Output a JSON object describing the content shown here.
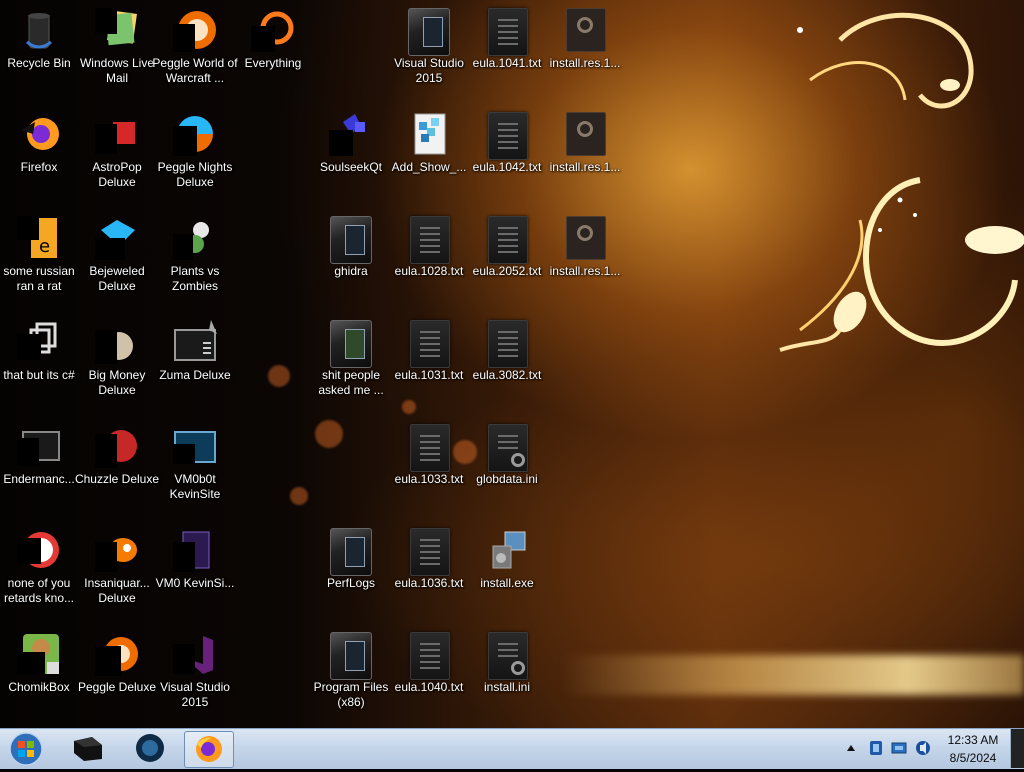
{
  "desktop": {
    "icons": [
      {
        "label": "Recycle Bin",
        "icon": "recycle-bin-icon"
      },
      {
        "label": "Windows Live Mail",
        "icon": "windows-live-mail-icon"
      },
      {
        "label": "Peggle World of Warcraft ...",
        "icon": "peggle-icon"
      },
      {
        "label": "Everything",
        "icon": "everything-search-icon"
      },
      {
        "label": "Visual Studio 2015",
        "icon": "folder-icon"
      },
      {
        "label": "eula.1041.txt",
        "icon": "text-file-icon"
      },
      {
        "label": "install.res.1...",
        "icon": "resource-file-icon"
      },
      {
        "label": "Firefox",
        "icon": "firefox-icon"
      },
      {
        "label": "AstroPop Deluxe",
        "icon": "astropop-icon"
      },
      {
        "label": "Peggle Nights Deluxe",
        "icon": "peggle-nights-icon"
      },
      {
        "label": "SoulseekQt",
        "icon": "soulseek-icon"
      },
      {
        "label": "Add_Show_...",
        "icon": "registry-file-icon"
      },
      {
        "label": "eula.1042.txt",
        "icon": "text-file-icon"
      },
      {
        "label": "install.res.1...",
        "icon": "resource-file-icon"
      },
      {
        "label": "some russian ran a rat",
        "icon": "exe-file-icon"
      },
      {
        "label": "Bejeweled Deluxe",
        "icon": "bejeweled-icon"
      },
      {
        "label": "Plants vs Zombies",
        "icon": "plants-vs-zombies-icon"
      },
      {
        "label": "ghidra",
        "icon": "folder-icon"
      },
      {
        "label": "eula.1028.txt",
        "icon": "text-file-icon"
      },
      {
        "label": "eula.2052.txt",
        "icon": "text-file-icon"
      },
      {
        "label": "install.res.1...",
        "icon": "resource-file-icon"
      },
      {
        "label": "that but its c#",
        "icon": "shortcut-icon"
      },
      {
        "label": "Big Money Deluxe",
        "icon": "big-money-icon"
      },
      {
        "label": "Zuma Deluxe",
        "icon": "window-app-icon"
      },
      {
        "label": "shit people asked me ...",
        "icon": "folder-icon"
      },
      {
        "label": "eula.1031.txt",
        "icon": "text-file-icon"
      },
      {
        "label": "eula.3082.txt",
        "icon": "text-file-icon"
      },
      {
        "label": "Endermanc...",
        "icon": "window-app-icon"
      },
      {
        "label": "Chuzzle Deluxe",
        "icon": "chuzzle-icon"
      },
      {
        "label": "VM0b0t KevinSite",
        "icon": "window-app-icon"
      },
      {
        "label": "eula.1033.txt",
        "icon": "text-file-icon"
      },
      {
        "label": "globdata.ini",
        "icon": "settings-file-icon"
      },
      {
        "label": "none of you retards kno...",
        "icon": "chrome-like-icon"
      },
      {
        "label": "Insaniquar... Deluxe",
        "icon": "insaniquarium-icon"
      },
      {
        "label": "VM0 KevinSi...",
        "icon": "document-icon"
      },
      {
        "label": "PerfLogs",
        "icon": "folder-icon"
      },
      {
        "label": "eula.1036.txt",
        "icon": "text-file-icon"
      },
      {
        "label": "install.exe",
        "icon": "installer-icon"
      },
      {
        "label": "ChomikBox",
        "icon": "chomikbox-icon"
      },
      {
        "label": "Peggle Deluxe",
        "icon": "peggle-icon"
      },
      {
        "label": "Visual Studio 2015",
        "icon": "visual-studio-icon"
      },
      {
        "label": "Program Files (x86)",
        "icon": "folder-icon"
      },
      {
        "label": "eula.1040.txt",
        "icon": "text-file-icon"
      },
      {
        "label": "install.ini",
        "icon": "settings-file-icon"
      }
    ]
  },
  "taskbar": {
    "start_icon": "windows-start-orb-icon",
    "pinned": [
      {
        "name": "file-explorer",
        "icon": "black-box-icon"
      },
      {
        "name": "app-blue-globe",
        "icon": "blue-globe-icon"
      },
      {
        "name": "firefox",
        "icon": "firefox-icon",
        "active": true
      }
    ],
    "tray": {
      "show_hidden_icon": "up-arrow-icon",
      "icons": [
        "app-tray-icon",
        "network-icon",
        "volume-icon"
      ],
      "time": "12:33 AM",
      "date": "8/5/2024"
    }
  },
  "colors": {
    "taskbar_top": "#dbe6f3",
    "taskbar_bottom": "#b4c7df",
    "wallpaper_accent": "#d98a2a"
  }
}
